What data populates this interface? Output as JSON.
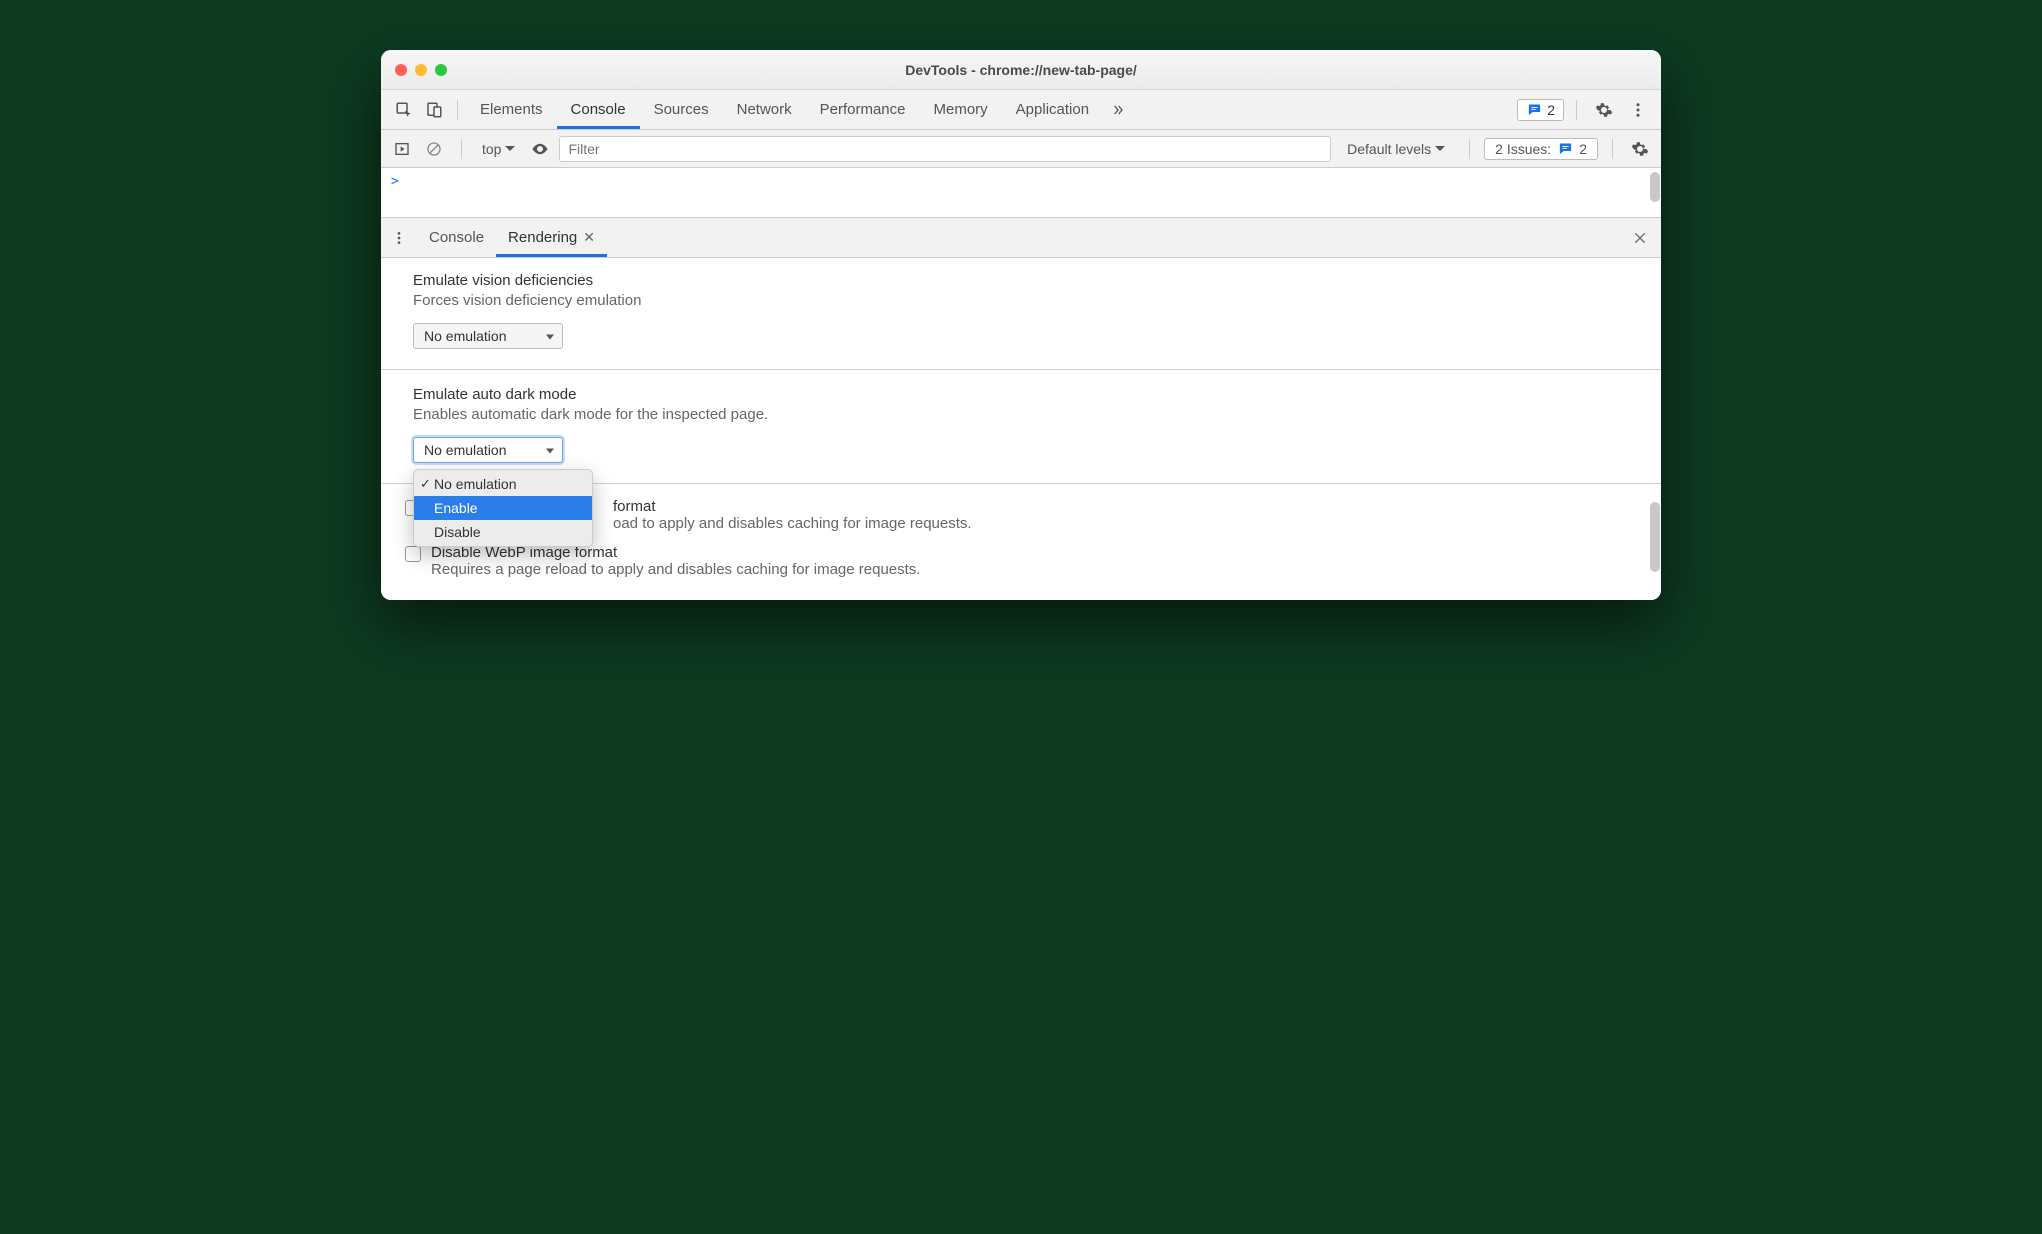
{
  "window": {
    "title": "DevTools - chrome://new-tab-page/"
  },
  "tabs": {
    "items": [
      "Elements",
      "Console",
      "Sources",
      "Network",
      "Performance",
      "Memory",
      "Application"
    ],
    "active": "Console",
    "issues_badge_count": "2"
  },
  "console": {
    "context": "top",
    "filter_placeholder": "Filter",
    "levels": "Default levels",
    "issues_label": "2 Issues:",
    "issues_count": "2",
    "prompt": ">"
  },
  "drawer": {
    "tabs": [
      "Console",
      "Rendering"
    ],
    "active": "Rendering"
  },
  "rendering": {
    "vision": {
      "title": "Emulate vision deficiencies",
      "desc": "Forces vision deficiency emulation",
      "select_value": "No emulation"
    },
    "darkmode": {
      "title": "Emulate auto dark mode",
      "desc": "Enables automatic dark mode for the inspected page.",
      "select_value": "No emulation",
      "options": [
        "No emulation",
        "Enable",
        "Disable"
      ],
      "selected_index": 0,
      "highlighted_index": 1
    },
    "avif": {
      "label": "format",
      "desc_fragment": "oad to apply and disables caching for image requests."
    },
    "webp": {
      "label": "Disable WebP image format",
      "desc": "Requires a page reload to apply and disables caching for image requests."
    }
  }
}
